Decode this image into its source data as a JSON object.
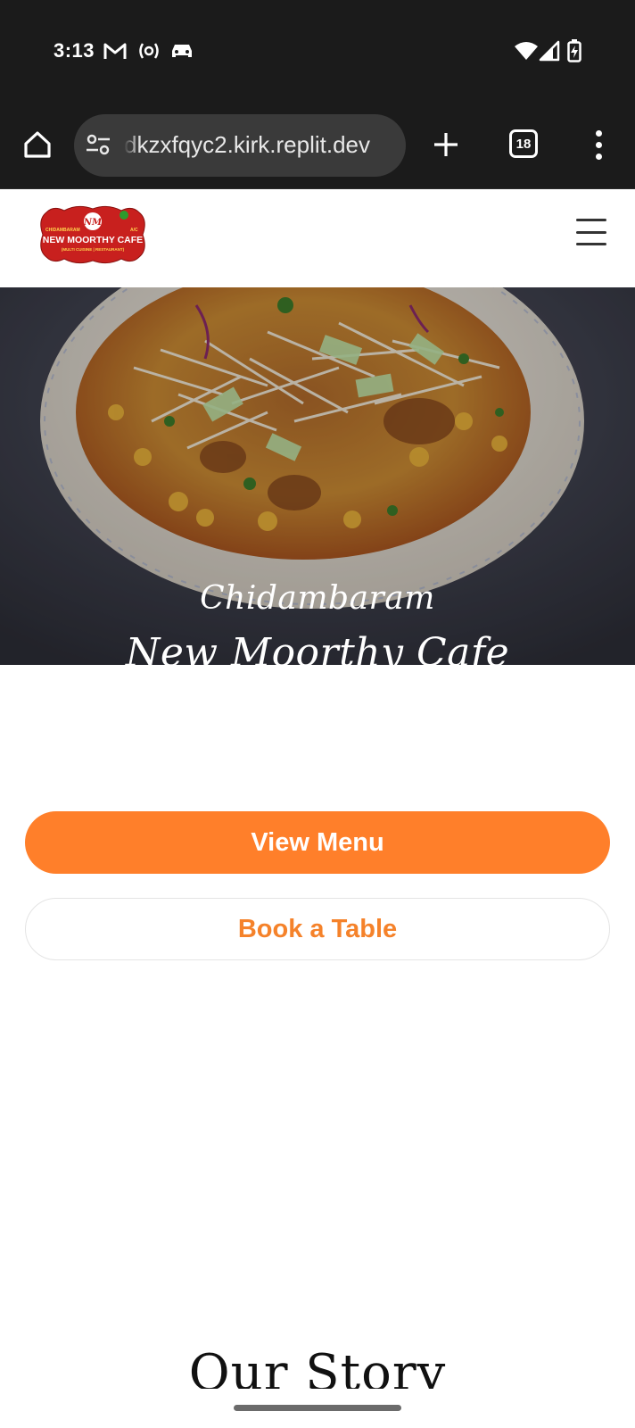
{
  "status_bar": {
    "time": "3:13",
    "icons": [
      "gmail-icon",
      "hotspot-icon",
      "car-icon",
      "wifi-icon",
      "signal-icon",
      "battery-charging-icon"
    ]
  },
  "browser": {
    "url": "dkzxfqyc2.kirk.replit.dev",
    "tab_count": "18",
    "icons": [
      "home-icon",
      "site-settings-icon",
      "new-tab-icon",
      "tabs-icon",
      "more-options-icon"
    ]
  },
  "site": {
    "logo": {
      "top_left": "CHIDAMBARAM",
      "top_right": "A/C",
      "name": "NEW MOORTHY CAFE",
      "tagline": "(MULTI CUISINE | RESTAURANT)"
    },
    "hero": {
      "line1": "Chidambaram",
      "line2": "New Moorthy Cafe"
    },
    "buttons": {
      "view_menu": "View Menu",
      "book_table": "Book a Table"
    },
    "story_heading": "Our Story"
  },
  "colors": {
    "accent": "#ff7f2a",
    "accent_text": "#f5822a",
    "chrome_dark": "#1b1b1b",
    "url_pill": "#3a3a3a",
    "logo_red": "#c8201e"
  }
}
